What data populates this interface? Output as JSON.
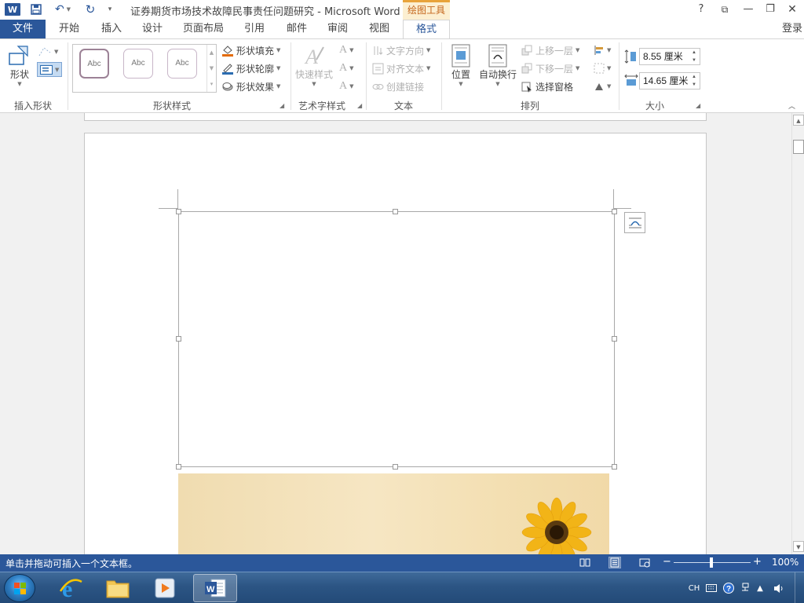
{
  "titlebar": {
    "doc_title": "证券期货市场技术故障民事责任问题研究 - Microsoft Word",
    "context_tab": "绘图工具",
    "help": "?",
    "ribbon_display": "⧉",
    "minimize": "—",
    "restore": "❐",
    "close": "✕"
  },
  "tabs": {
    "file": "文件",
    "items": [
      "开始",
      "插入",
      "设计",
      "页面布局",
      "引用",
      "邮件",
      "审阅",
      "视图",
      "格式"
    ],
    "login": "登录"
  },
  "ribbon": {
    "insert_shapes": {
      "label": "插入形状",
      "shapes": "形状"
    },
    "shape_styles": {
      "label": "形状样式",
      "gallery": [
        "Abc",
        "Abc",
        "Abc"
      ],
      "fill": "形状填充",
      "outline": "形状轮廓",
      "effects": "形状效果"
    },
    "wordart": {
      "label": "艺术字样式",
      "quick_styles": "快速样式",
      "letter": "A"
    },
    "text": {
      "label": "文本",
      "direction": "文字方向",
      "align": "对齐文本",
      "link": "创建链接"
    },
    "arrange": {
      "label": "排列",
      "position": "位置",
      "wrap": "自动换行",
      "bring_forward": "上移一层",
      "send_backward": "下移一层",
      "selection_pane": "选择窗格"
    },
    "size": {
      "label": "大小",
      "height": "8.55 厘米",
      "width": "14.65 厘米"
    }
  },
  "statusbar": {
    "text": "单击并拖动可插入一个文本框。",
    "zoom_minus": "−",
    "zoom_plus": "+",
    "zoom": "100%"
  },
  "taskbar": {
    "lang": "CH"
  },
  "colors": {
    "word_blue": "#2b579a",
    "context_orange": "#c4661c",
    "context_bg": "#fcefd1"
  }
}
